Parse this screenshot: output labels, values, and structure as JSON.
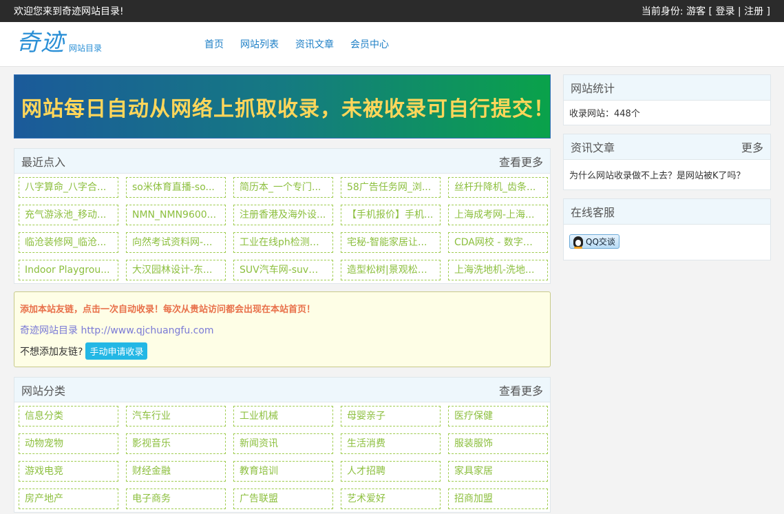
{
  "topbar": {
    "welcome": "欢迎您来到奇迹网站目录!",
    "identity_label": "当前身份:",
    "identity_value": "游客",
    "open_bracket": "[",
    "login": "登录",
    "separator": "|",
    "register": "注册",
    "close_bracket": "]"
  },
  "header": {
    "logo_mark": "奇迹",
    "logo_sub": "网站目录",
    "nav": [
      "首页",
      "网站列表",
      "资讯文章",
      "会员中心"
    ]
  },
  "banner": {
    "text": "网站每日自动从网络上抓取收录，未被收录可自行提交！"
  },
  "recent": {
    "title": "最近点入",
    "more": "查看更多",
    "items": [
      "八字算命_八字合...",
      "so米体育直播-so...",
      "简历本_一个专门...",
      "58广告任务网_浏...",
      "丝杆升降机_齿条...",
      "充气游泳池_移动...",
      "NMN_NMN9600...",
      "注册香港及海外设...",
      "【手机报价】手机...",
      "上海成考网-上海...",
      "临沧装修网_临沧...",
      "向然考试资料网-...",
      "工业在线ph检测仪...",
      "宅秘-智能家居让...",
      "CDA网校 - 数字化...",
      "Indoor Playgrou...",
      "大汉园林设计-东...",
      "SUV汽车网-suv汽...",
      "造型松树|景观松树...",
      "上海洗地机-洗地..."
    ]
  },
  "notice": {
    "line1": "添加本站友链，点击一次自动收录！每次从贵站访问都会出现在本站首页！",
    "line2": "奇迹网站目录 http://www.qjchuangfu.com",
    "line3": "不想添加友链?",
    "button": "手动申请收录"
  },
  "categories": {
    "title": "网站分类",
    "more": "查看更多",
    "items": [
      "信息分类",
      "汽车行业",
      "工业机械",
      "母婴亲子",
      "医疗保健",
      "动物宠物",
      "影视音乐",
      "新闻资讯",
      "生活消费",
      "服装服饰",
      "游戏电竞",
      "财经金融",
      "教育培训",
      "人才招聘",
      "家具家居",
      "房产地产",
      "电子商务",
      "广告联盟",
      "艺术爱好",
      "招商加盟"
    ]
  },
  "sidebar": {
    "stats": {
      "title": "网站统计",
      "text": "收录网站：448个"
    },
    "articles": {
      "title": "资讯文章",
      "more": "更多",
      "item": "为什么网站收录做不上去？是网站被K了吗？"
    },
    "service": {
      "title": "在线客服",
      "qq_label": "QQ交谈"
    }
  }
}
